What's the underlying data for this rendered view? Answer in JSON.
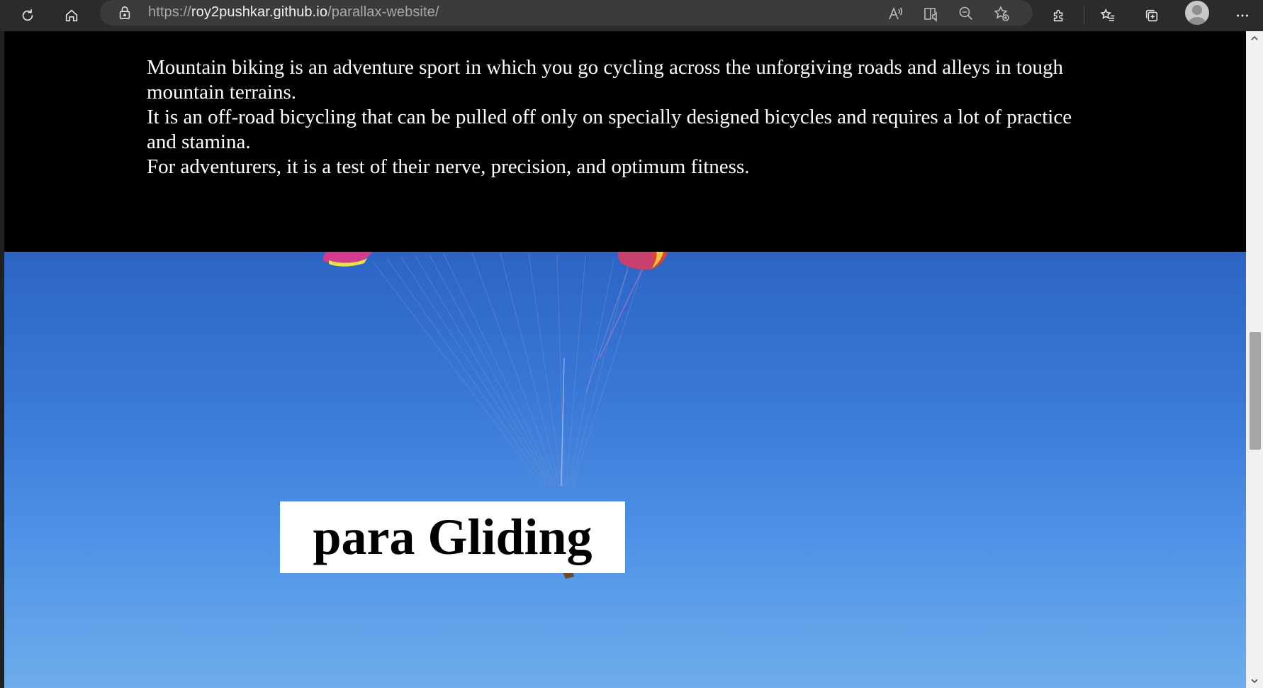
{
  "browser": {
    "url_scheme": "https://",
    "url_host": "roy2pushkar.github.io",
    "url_path": "/parallax-website/",
    "icons": {
      "refresh": "refresh-icon",
      "home": "home-icon",
      "lock": "lock-icon",
      "read_aloud": "read-aloud-icon",
      "immersive_reader": "immersive-reader-icon",
      "zoom": "zoom-out-icon",
      "add_favorite": "add-favorite-icon",
      "extensions": "extensions-icon",
      "favorites": "favorites-icon",
      "collections": "collections-icon",
      "profile": "profile-avatar",
      "more": "more-icon"
    }
  },
  "page": {
    "paragraph_lines": [
      "Mountain biking is an adventure sport in which you go cycling across the unforgiving roads and alleys in tough mountain terrains.",
      "It is an off-road bicycling that can be pulled off only on specially designed bicycles and requires a lot of practice and stamina.",
      "For adventurers, it is a test of their nerve, precision, and optimum fitness."
    ],
    "section_title": "para Gliding"
  },
  "colors": {
    "toolbar_bg": "#2b2b2b",
    "sky_top": "#2c64c4",
    "sky_bottom": "#6eaceb",
    "text_section_bg": "#000000",
    "title_box_bg": "#ffffff"
  }
}
